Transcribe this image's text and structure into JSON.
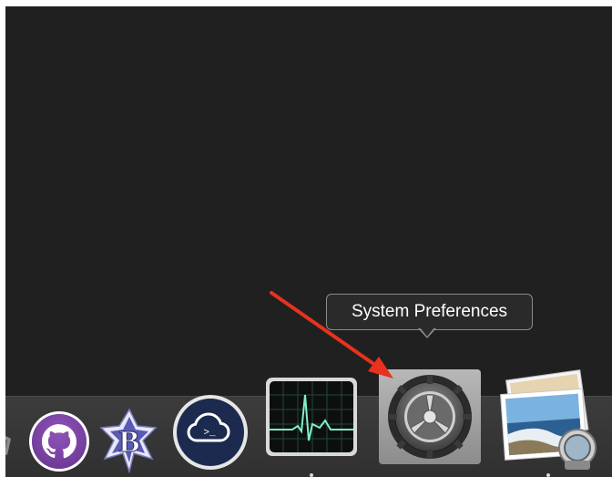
{
  "tooltip": {
    "label": "System Preferences"
  },
  "dock": {
    "items": [
      {
        "icon": "partial-app-icon"
      },
      {
        "icon": "github-desktop-icon"
      },
      {
        "icon": "bbedit-icon"
      },
      {
        "icon": "terminal-cloud-app-icon"
      },
      {
        "icon": "activity-monitor-icon"
      },
      {
        "icon": "system-preferences-icon",
        "hovered": true
      },
      {
        "icon": "preview-icon"
      }
    ]
  },
  "annotation": {
    "arrow_color": "#e8321e"
  },
  "colors": {
    "desktop_background": "#202020",
    "dock_background": "#353535",
    "tooltip_background": "#2a2a2a"
  }
}
